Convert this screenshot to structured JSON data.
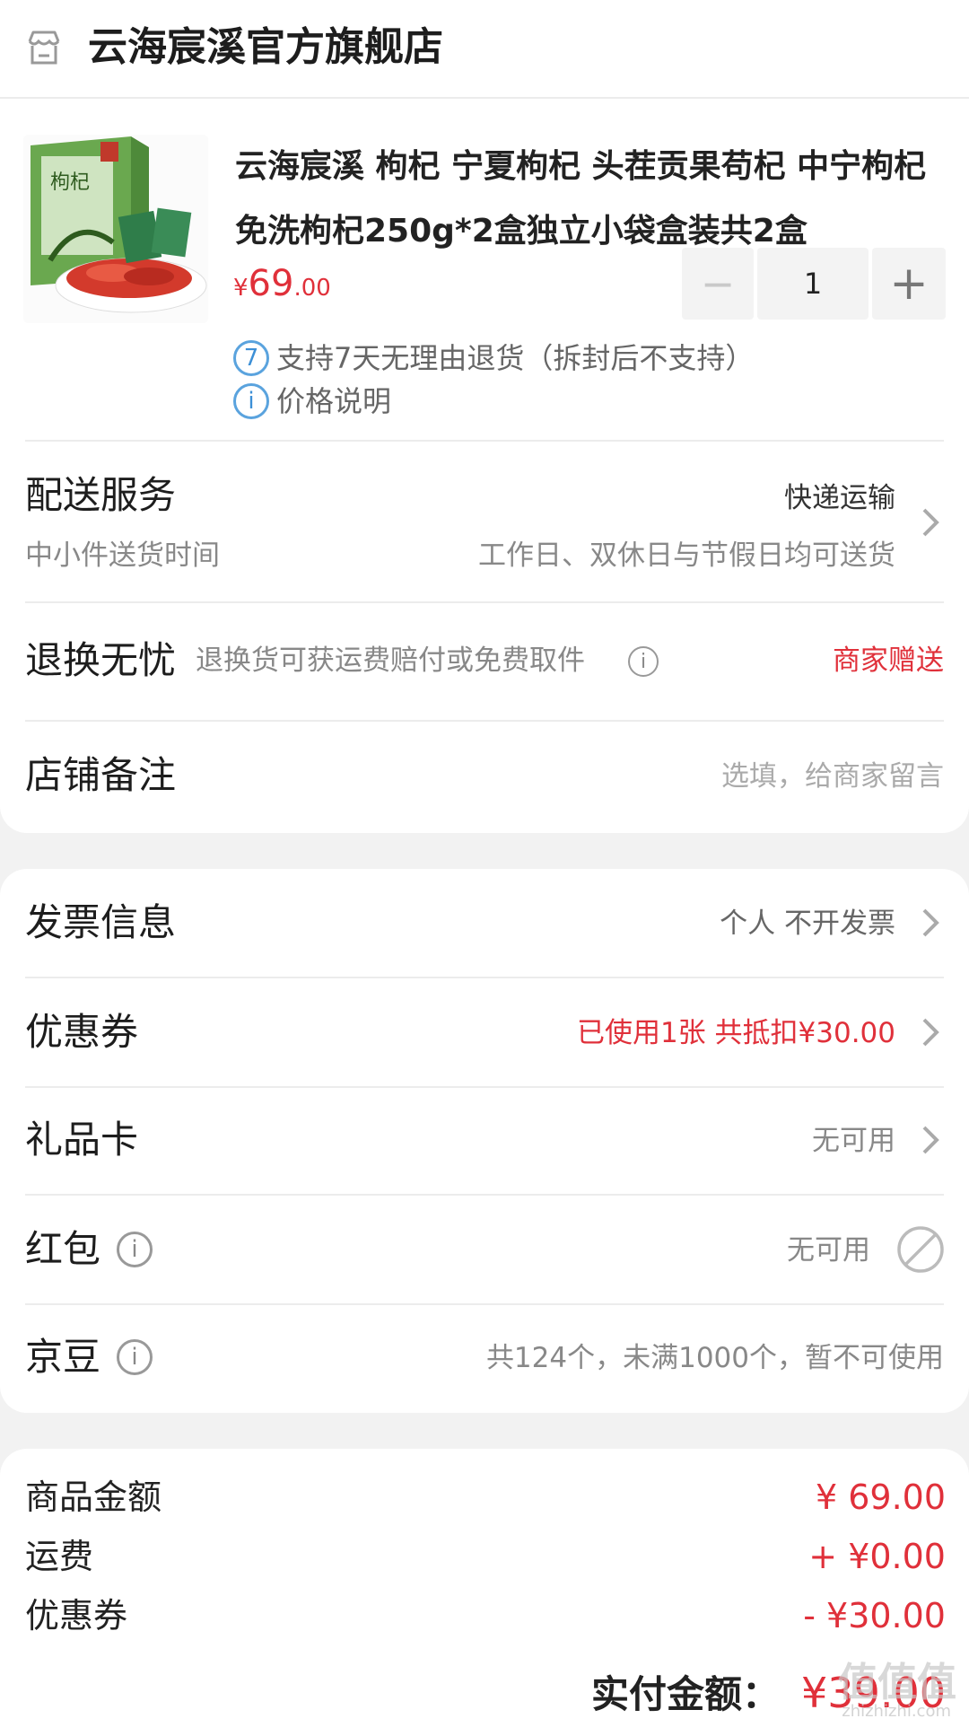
{
  "store": {
    "name": "云海宸溪官方旗舰店",
    "icon": "store-icon"
  },
  "product": {
    "title": "云海宸溪 枸杞 宁夏枸杞 头茬贡果苟杞 中宁枸杞 免洗枸杞250g*2盒独立小袋盒装共2盒",
    "image_label": "枸杞",
    "price_symbol": "¥",
    "price_int": "69",
    "price_dec": ".00",
    "quantity": "1",
    "minus": "−",
    "plus": "+",
    "return_badge": "7",
    "return_policy": "支持7天无理由退货（拆封后不支持）",
    "price_note_icon": "i",
    "price_note": "价格说明"
  },
  "delivery": {
    "title": "配送服务",
    "method": "快递运输",
    "sub_label": "中小件送货时间",
    "sub_value": "工作日、双休日与节假日均可送货"
  },
  "returns": {
    "title": "退换无忧",
    "desc": "退换货可获运费赔付或免费取件",
    "value": "商家赠送"
  },
  "note": {
    "title": "店铺备注",
    "placeholder": "选填，给商家留言"
  },
  "invoice": {
    "title": "发票信息",
    "value": "个人 不开发票"
  },
  "coupon": {
    "title": "优惠券",
    "value": "已使用1张 共抵扣¥30.00"
  },
  "giftcard": {
    "title": "礼品卡",
    "value": "无可用"
  },
  "redpacket": {
    "title": "红包",
    "value": "无可用"
  },
  "jingdou": {
    "title": "京豆",
    "value": "共124个，未满1000个，暂不可使用"
  },
  "summary": {
    "goods_label": "商品金额",
    "goods_value": "¥ 69.00",
    "freight_label": "运费",
    "freight_value": "+ ¥0.00",
    "coupon_label": "优惠券",
    "coupon_value": "- ¥30.00",
    "total_label": "实付金额：",
    "total_value": "¥39.00"
  },
  "watermark": {
    "main": "值值值",
    "sub": "zhizhizhi.com"
  },
  "colors": {
    "accent_red": "#e0303a",
    "info_blue": "#3c8fd6",
    "background": "#f2f2f2"
  }
}
